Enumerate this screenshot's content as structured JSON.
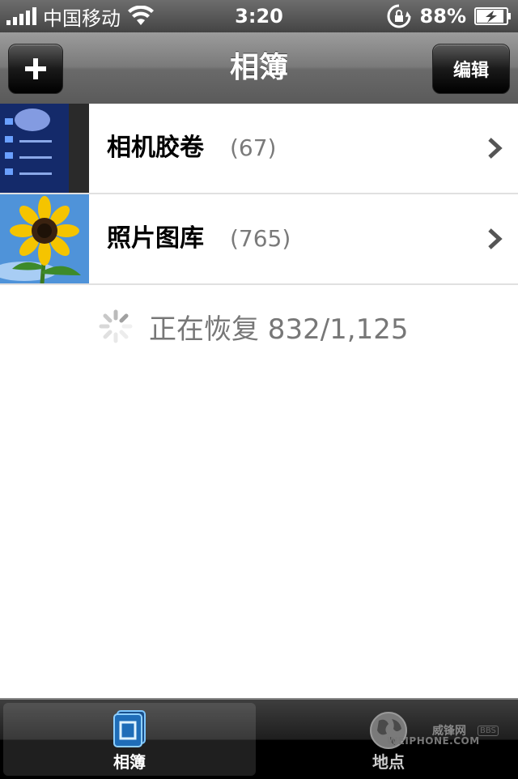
{
  "status_bar": {
    "carrier": "中国移动",
    "time": "3:20",
    "battery": "88%"
  },
  "nav": {
    "title": "相簿",
    "add_icon": "plus-icon",
    "edit_label": "编辑"
  },
  "albums": [
    {
      "name": "相机胶卷",
      "count": "(67)",
      "thumb_icon": "camera-roll-thumbnail"
    },
    {
      "name": "照片图库",
      "count": "(765)",
      "thumb_icon": "sunflower-thumbnail"
    }
  ],
  "restore": {
    "text": "正在恢复 832/1,125"
  },
  "tab_bar": {
    "tabs": [
      {
        "label": "相簿",
        "icon": "albums-icon",
        "selected": true
      },
      {
        "label": "地点",
        "icon": "globe-icon",
        "selected": false
      }
    ]
  },
  "watermark": {
    "text": "威锋网",
    "badge": "BBS",
    "brand": "WEIPHONE.COM"
  }
}
